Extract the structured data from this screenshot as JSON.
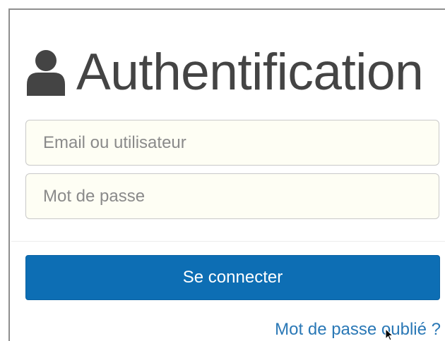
{
  "header": {
    "icon": "user-icon",
    "title": "Authentification"
  },
  "form": {
    "email": {
      "value": "",
      "placeholder": "Email ou utilisateur"
    },
    "password": {
      "value": "",
      "placeholder": "Mot de passe"
    },
    "submit_label": "Se connecter",
    "forgot_label": "Mot de passe oublié ?"
  },
  "colors": {
    "primary": "#0d6eb4",
    "link": "#2a78b6",
    "title": "#444444",
    "input_bg": "#fefef4"
  }
}
